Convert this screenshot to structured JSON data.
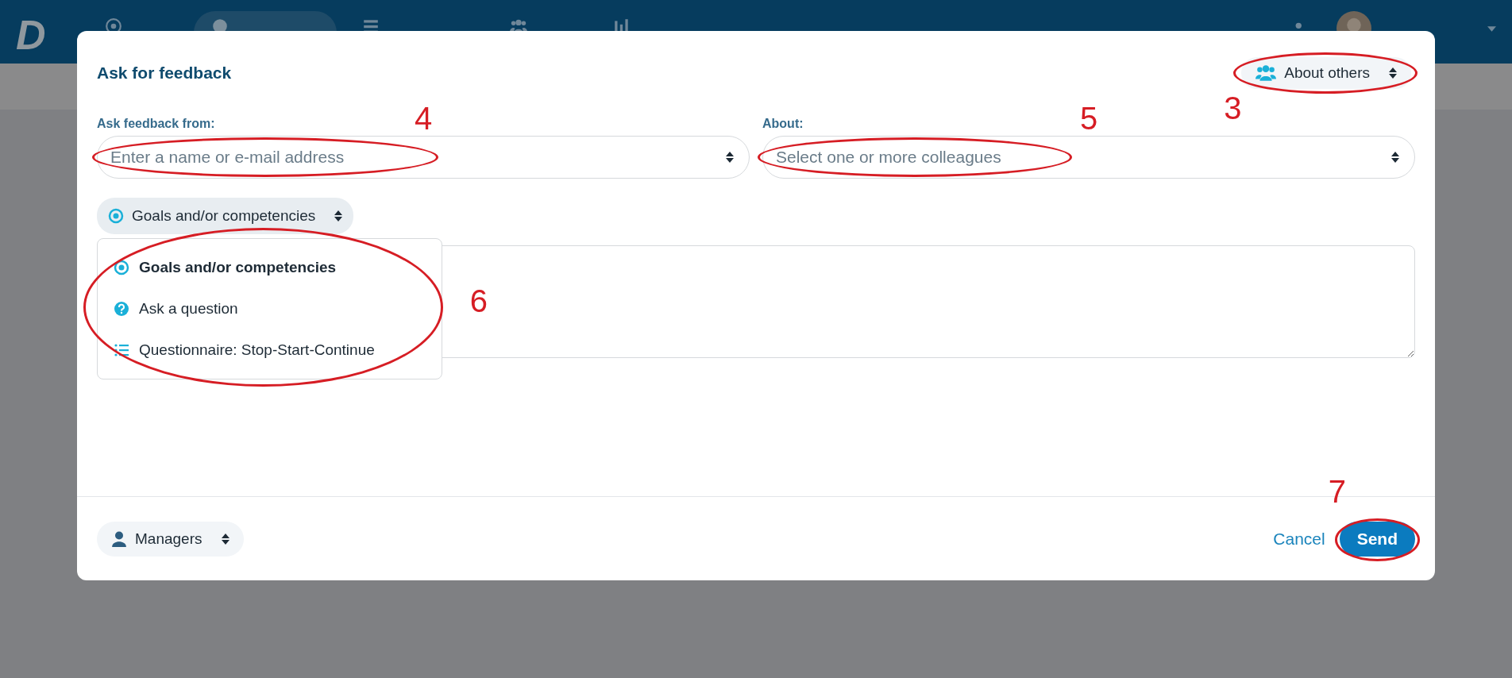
{
  "nav": {
    "logo": "D",
    "items": [
      {
        "selected": false
      },
      {
        "selected": true
      },
      {
        "selected": false
      },
      {
        "selected": false
      },
      {
        "selected": false
      }
    ]
  },
  "dialog": {
    "title": "Ask for feedback",
    "about_toggle": {
      "label": "About others",
      "callout": "3"
    },
    "from": {
      "label": "Ask feedback from:",
      "placeholder": "Enter a name or e-mail address",
      "callout": "4"
    },
    "about": {
      "label": "About:",
      "placeholder": "Select one or more colleagues",
      "callout": "5"
    },
    "type_select": {
      "label": "Goals and/or competencies",
      "expanded": true,
      "callout": "6"
    },
    "type_options": [
      {
        "label": "Goals and/or competencies",
        "kind": "goals",
        "selected": true
      },
      {
        "label": "Ask a question",
        "kind": "question",
        "selected": false
      },
      {
        "label": "Questionnaire: Stop-Start-Continue",
        "kind": "questionnaire",
        "selected": false
      }
    ],
    "visibility": {
      "label": "Managers"
    },
    "cancel": "Cancel",
    "send": {
      "label": "Send",
      "callout": "7"
    }
  }
}
